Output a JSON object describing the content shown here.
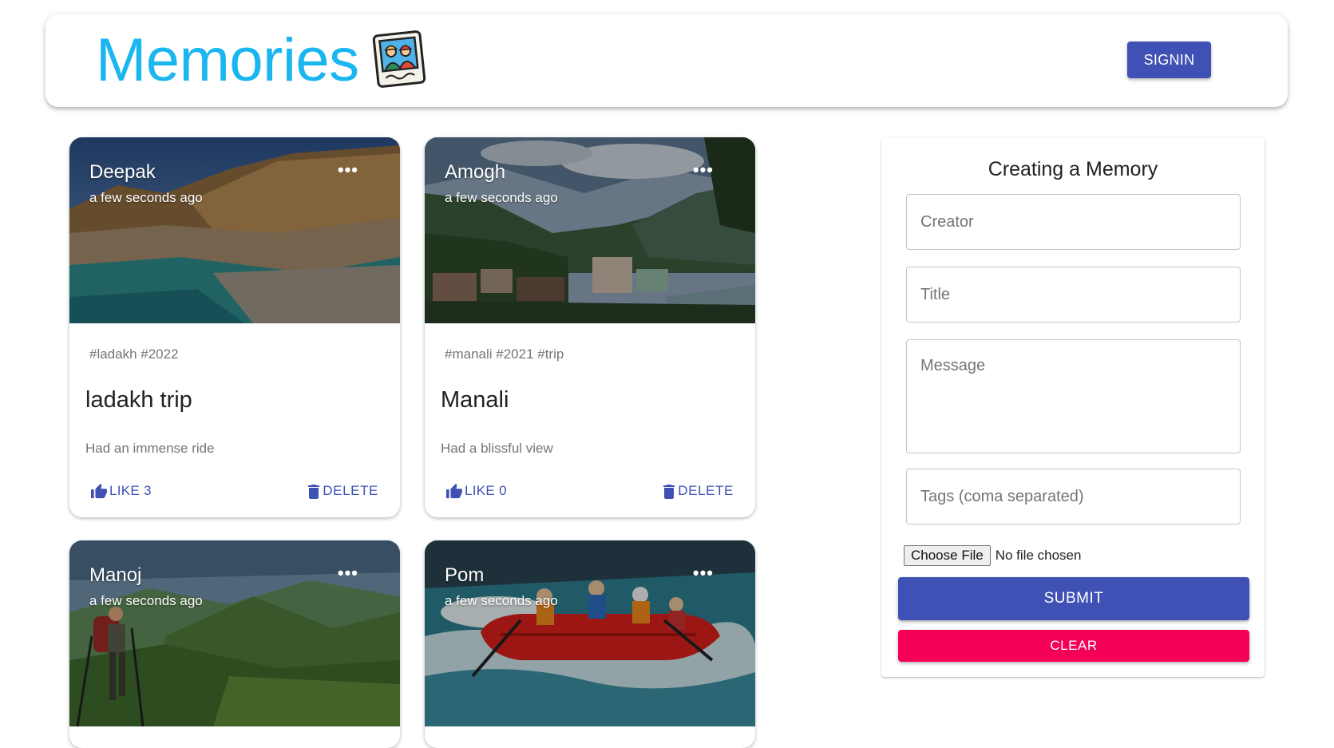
{
  "header": {
    "brand": "Memories",
    "brand_icon": "photo-memories-icon",
    "signin_label": "SIGNIN",
    "brand_color": "#1ab6f0",
    "primary_color": "#3f51b5"
  },
  "posts": [
    {
      "creator": "Deepak",
      "time": "a few seconds ago",
      "more": "•••",
      "tags": "#ladakh #2022",
      "title": "ladakh trip",
      "message": "Had an immense ride",
      "like_label": "LIKE 3",
      "delete_label": "DELETE",
      "image": "river-mountain-photo"
    },
    {
      "creator": "Amogh",
      "time": "a few seconds ago",
      "more": "•••",
      "tags": "#manali #2021 #trip",
      "title": "Manali",
      "message": "Had a blissful view",
      "like_label": "LIKE 0",
      "delete_label": "DELETE",
      "image": "valley-town-photo"
    },
    {
      "creator": "Manoj",
      "time": "a few seconds ago",
      "more": "•••",
      "image": "hiker-hills-photo"
    },
    {
      "creator": "Pom",
      "time": "a few seconds ago",
      "more": "•••",
      "image": "river-rafting-photo"
    }
  ],
  "form": {
    "title": "Creating a Memory",
    "creator_placeholder": "Creator",
    "title_placeholder": "Title",
    "message_placeholder": "Message",
    "tags_placeholder": "Tags (coma separated)",
    "file_button": "Choose File",
    "file_status": "No file chosen",
    "submit_label": "SUBMIT",
    "clear_label": "CLEAR",
    "clear_color": "#f50057"
  }
}
